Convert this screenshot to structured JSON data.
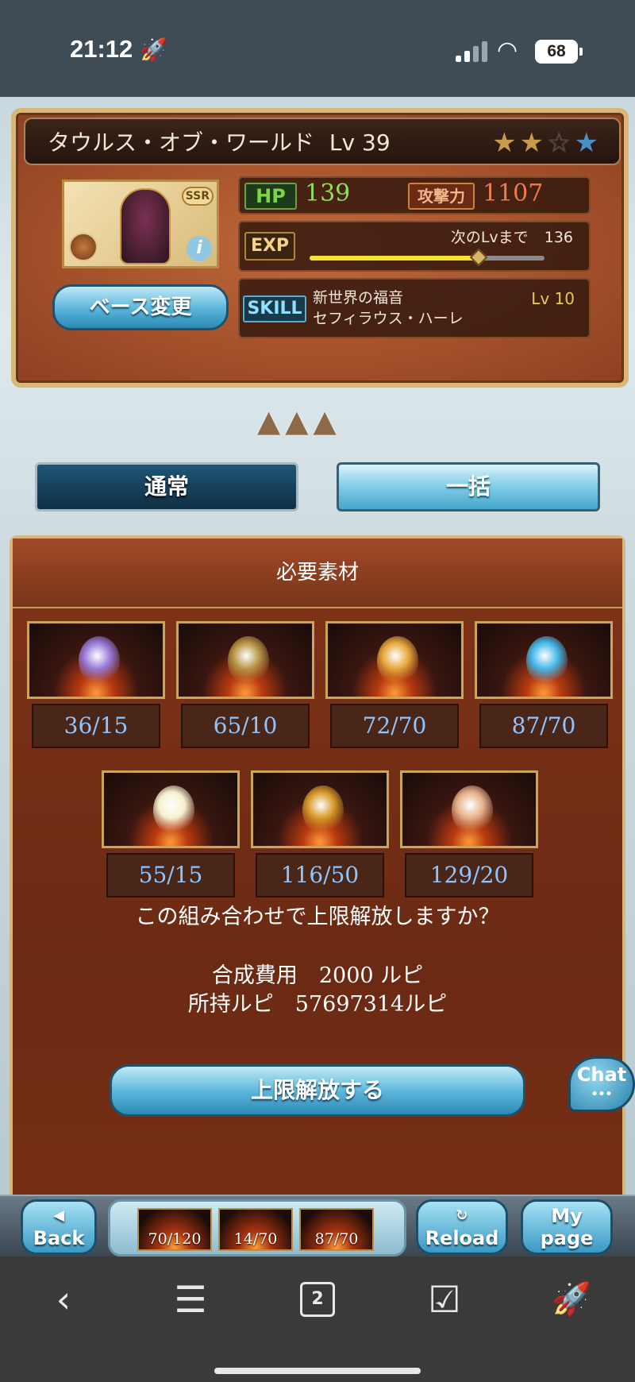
{
  "status": {
    "time": "21:12",
    "battery": "68"
  },
  "character": {
    "name": "タウルス・オブ・ワールド",
    "level_label": "Lv",
    "level": "39",
    "rarity": "SSR",
    "hp_label": "HP",
    "hp": "139",
    "atk_label": "攻撃力",
    "atk": "1107",
    "exp_label": "EXP",
    "next_label": "次のLvまで",
    "next_value": "136",
    "exp_progress": 0.72,
    "skill_label": "SKILL",
    "skill_name_1": "新世界の福音",
    "skill_name_2": "セフィラウス・ハーレ",
    "skill_level": "Lv 10",
    "stars_filled": 2,
    "stars_total": 4,
    "base_change": "ベース変更",
    "info_icon": "i"
  },
  "modes": {
    "normal": "通常",
    "bulk": "一括"
  },
  "materials": {
    "title": "必要素材",
    "items": [
      {
        "count": "36/15",
        "icon_color": "#9a7bd8"
      },
      {
        "count": "65/10",
        "icon_color": "#b89646"
      },
      {
        "count": "72/70",
        "icon_color": "#e7a73b"
      },
      {
        "count": "87/70",
        "icon_color": "#46b9ea"
      },
      {
        "count": "55/15",
        "icon_color": "#f6f0d0"
      },
      {
        "count": "116/50",
        "icon_color": "#d79a2a"
      },
      {
        "count": "129/20",
        "icon_color": "#e7b18a"
      }
    ]
  },
  "confirm": {
    "question": "この組み合わせで上限解放しますか？",
    "cost_line": "合成費用　2000 ルピ",
    "owned_line": "所持ルピ　57697314ルピ",
    "submit": "上限解放する"
  },
  "chat": {
    "label": "Chat",
    "dots": "•••"
  },
  "nav": {
    "back": "Back",
    "reload": "Reload",
    "mypage_1": "My",
    "mypage_2": "page",
    "tray": [
      "70/120",
      "14/70",
      "87/70"
    ]
  },
  "browser": {
    "back": "‹",
    "menu": "☰",
    "tabs": "2",
    "check": "☑",
    "rocket": "🚀"
  }
}
